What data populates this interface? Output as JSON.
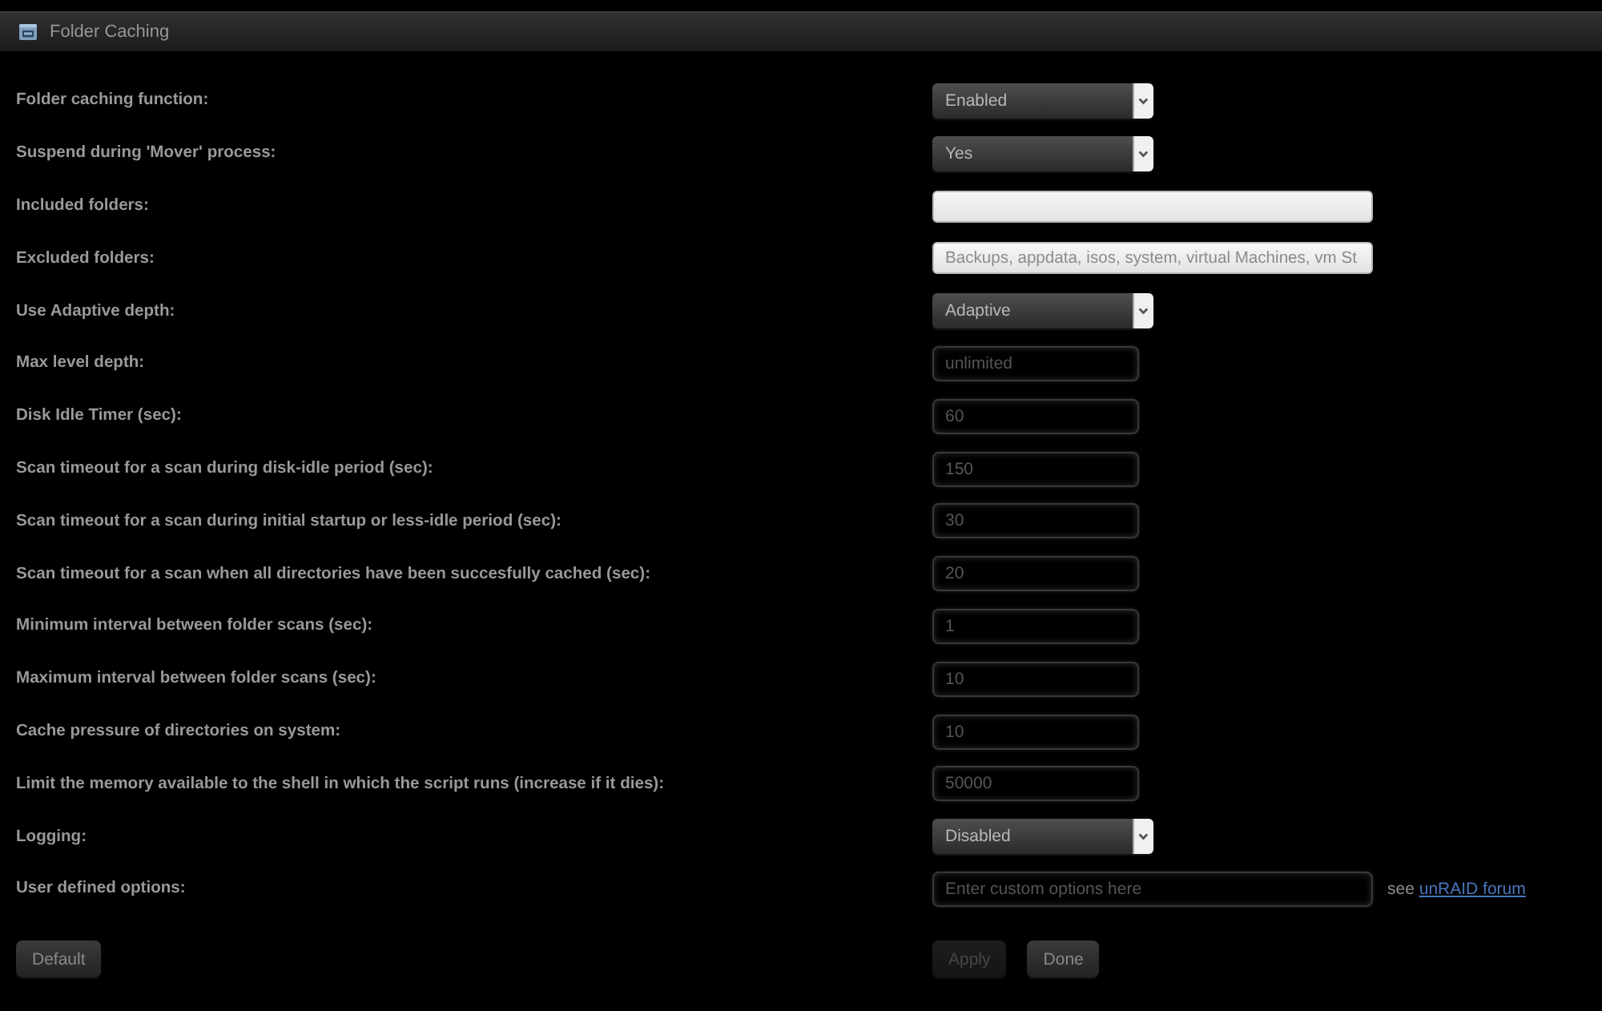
{
  "panel": {
    "title": "Folder Caching"
  },
  "settings": [
    {
      "label": "Folder caching function:",
      "kind": "select",
      "value": "Enabled"
    },
    {
      "label": "Suspend during 'Mover' process:",
      "kind": "select",
      "value": "Yes"
    },
    {
      "label": "Included folders:",
      "kind": "list"
    },
    {
      "label": "Excluded folders:",
      "kind": "list",
      "value": "Backups, appdata, isos, system, virtual Machines, vm St"
    },
    {
      "label": "Use Adaptive depth:",
      "kind": "select",
      "value": "Adaptive"
    },
    {
      "label": "Max level depth:",
      "kind": "number",
      "placeholder": "unlimited"
    },
    {
      "label": "Disk Idle Timer (sec):",
      "kind": "number",
      "placeholder": "60"
    },
    {
      "label": "Scan timeout for a scan during disk-idle period (sec):",
      "kind": "number",
      "placeholder": "150"
    },
    {
      "label": "Scan timeout for a scan during initial startup or less-idle period (sec):",
      "kind": "number",
      "placeholder": "30"
    },
    {
      "label": "Scan timeout for a scan when all directories have been succesfully cached (sec):",
      "kind": "number",
      "placeholder": "20"
    },
    {
      "label": "Minimum interval between folder scans (sec):",
      "kind": "number",
      "placeholder": "1"
    },
    {
      "label": "Maximum interval between folder scans (sec):",
      "kind": "number",
      "placeholder": "10"
    },
    {
      "label": "Cache pressure of directories on system:",
      "kind": "number",
      "placeholder": "10"
    },
    {
      "label": "Limit the memory available to the shell in which the script runs (increase if it dies):",
      "kind": "number",
      "placeholder": "50000"
    },
    {
      "label": "Logging:",
      "kind": "select",
      "value": "Disabled"
    },
    {
      "label": "User defined options:",
      "kind": "custom",
      "placeholder": "Enter custom options here",
      "note": "see",
      "link": "unRAID forum"
    }
  ],
  "buttons": [
    {
      "label": "Default",
      "kind": "reset",
      "disabled": false
    },
    {
      "label": "Apply",
      "kind": "action",
      "disabled": true
    },
    {
      "label": "Done",
      "kind": "action",
      "disabled": false
    }
  ]
}
